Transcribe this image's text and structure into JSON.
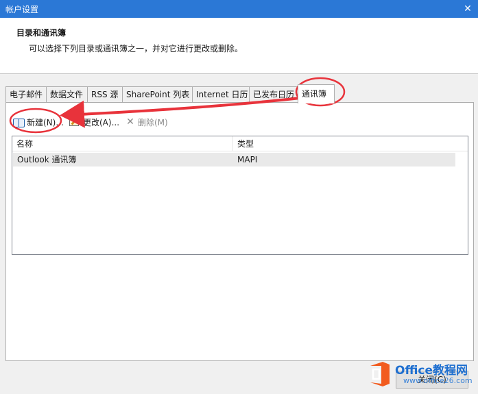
{
  "window": {
    "title": "帐户设置",
    "close_glyph": "✕"
  },
  "header": {
    "title": "目录和通讯簿",
    "description": "可以选择下列目录或通讯簿之一，并对它进行更改或删除。"
  },
  "tabs": [
    {
      "label": "电子邮件"
    },
    {
      "label": "数据文件"
    },
    {
      "label": "RSS 源"
    },
    {
      "label": "SharePoint 列表"
    },
    {
      "label": "Internet 日历"
    },
    {
      "label": "已发布日历"
    },
    {
      "label": "通讯簿"
    }
  ],
  "toolbar": {
    "new_label": "新建(N)...",
    "edit_label": "更改(A)...",
    "delete_label": "删除(M)",
    "delete_glyph": "✕"
  },
  "list": {
    "columns": [
      "名称",
      "类型"
    ],
    "rows": [
      {
        "name": "Outlook 通讯簿",
        "type": "MAPI"
      }
    ]
  },
  "footer": {
    "close_label": "关闭(C)"
  },
  "watermark": {
    "brand": "Office教程网",
    "url": "www.office26.com"
  },
  "colors": {
    "titlebar": "#2b78d6",
    "annotation": "#e8333b",
    "logo_orange": "#f25b1e"
  }
}
